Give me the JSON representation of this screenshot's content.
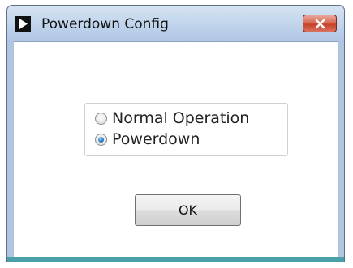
{
  "window": {
    "title": "Powerdown Config",
    "app_icon": "play-triangle-icon",
    "close_icon": "close-x-icon"
  },
  "radio_group": {
    "options": [
      {
        "label": "Normal Operation",
        "selected": false
      },
      {
        "label": "Powerdown",
        "selected": true
      }
    ]
  },
  "buttons": {
    "ok_label": "OK"
  },
  "colors": {
    "title_bar": "#bcd1ea",
    "close_button": "#c7412a",
    "radio_selected": "#2a7bc8",
    "status_line": "#4aa0a8"
  }
}
